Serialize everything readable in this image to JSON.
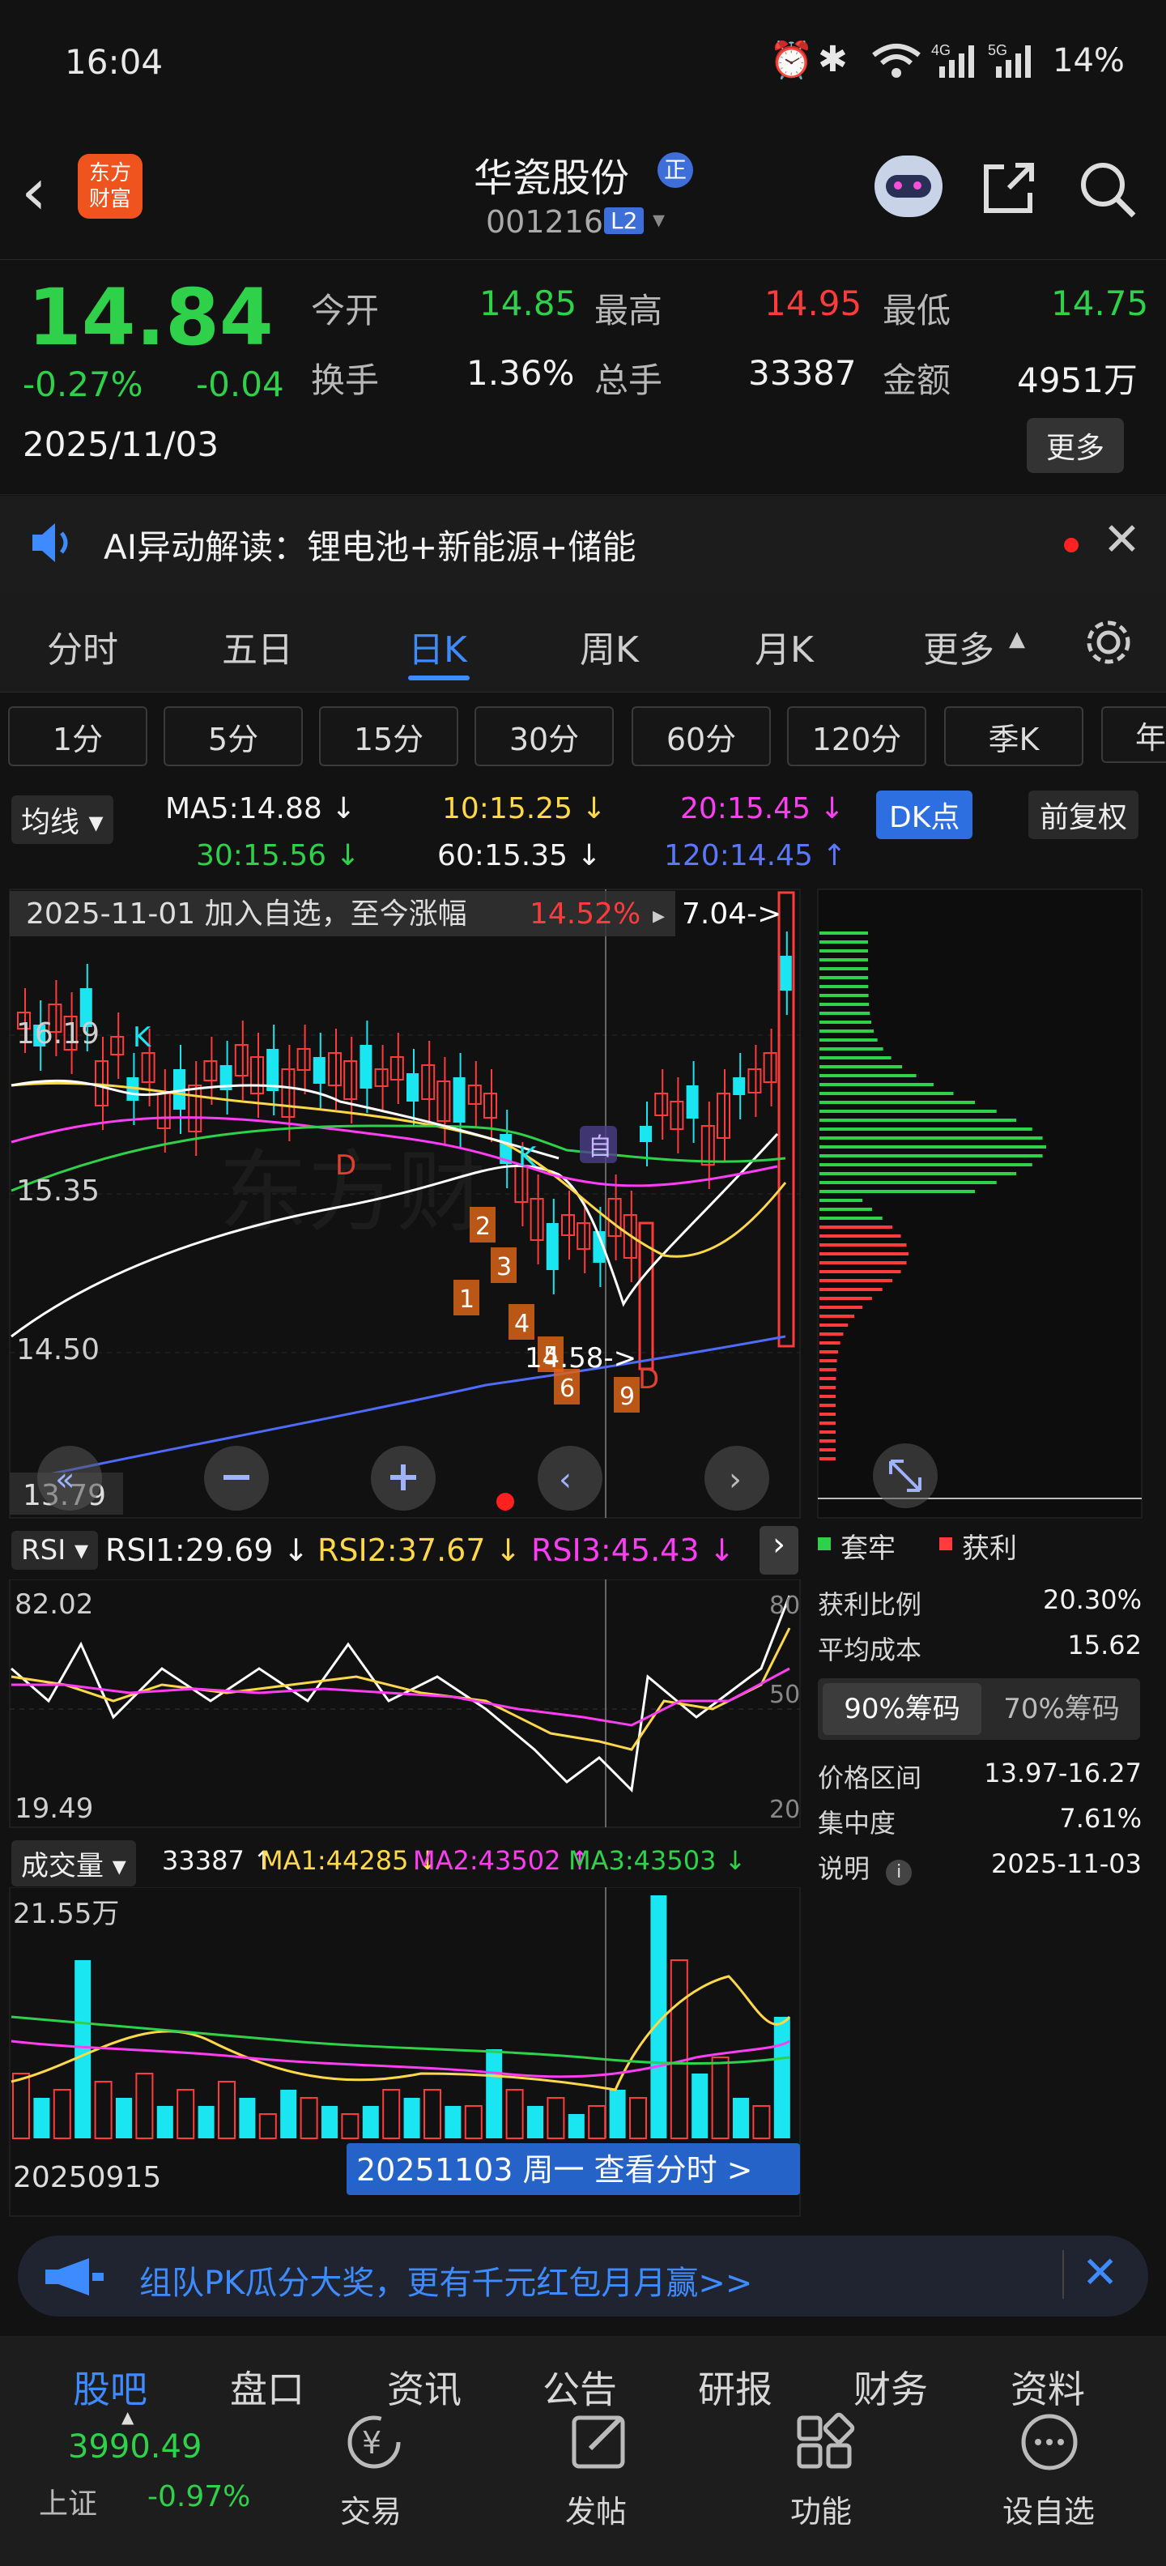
{
  "status_bar": {
    "time": "16:04",
    "network": "4G 5G",
    "battery": "14%"
  },
  "header": {
    "logo_text": "东方\n财富",
    "stock_name": "华瓷股份",
    "stock_badge": "正",
    "stock_code": "001216",
    "level_badge": "L2"
  },
  "quote": {
    "price": "14.84",
    "change_pct": "-0.27%",
    "change": "-0.04",
    "date": "2025/11/03",
    "open_label": "今开",
    "open": "14.85",
    "high_label": "最高",
    "high": "14.95",
    "low_label": "最低",
    "low": "14.75",
    "turnover_label": "换手",
    "turnover": "1.36%",
    "volume_label": "总手",
    "volume": "33387",
    "amount_label": "金额",
    "amount": "4951万",
    "more_button": "更多"
  },
  "ai_bar": {
    "text": "AI异动解读：锂电池+新能源+储能"
  },
  "tabs": [
    "分时",
    "五日",
    "日K",
    "周K",
    "月K",
    "更多"
  ],
  "active_tab": "日K",
  "periods": [
    "1分",
    "5分",
    "15分",
    "30分",
    "60分",
    "120分",
    "季K",
    "年"
  ],
  "ma_bar": {
    "selector": "均线",
    "ma5": "MA5:14.88 ↓",
    "ma10": "10:15.25 ↓",
    "ma20": "20:15.45 ↓",
    "ma30": "30:15.56 ↓",
    "ma60": "60:15.35 ↓",
    "ma120": "120:14.45 ↑",
    "dk_button": "DK点",
    "fq_button": "前复权"
  },
  "kline": {
    "banner_date": "2025-11-01 加入自选，至今涨幅",
    "banner_pct": "14.52%",
    "arrow_label": "7.04->",
    "y_high": "16.19",
    "y_mid": "15.35",
    "y_low": "14.50",
    "y_min": "13.79",
    "low_marker": "14.58->",
    "k_marker": "K",
    "d_marker": "D",
    "self_marker": "自",
    "seq_numbers": [
      "1",
      "2",
      "3",
      "4",
      "5",
      "6",
      "9"
    ]
  },
  "rsi": {
    "selector": "RSI",
    "rsi1": "RSI1:29.69 ↓",
    "rsi2": "RSI2:37.67 ↓",
    "rsi3": "RSI3:45.43 ↓",
    "y_top": "82.02",
    "y_bottom": "19.49",
    "right_top": "80",
    "right_mid": "50",
    "right_bottom": "20"
  },
  "volume": {
    "selector": "成交量",
    "vol": "33387 ↑",
    "ma1": "MA1:44285 ↓",
    "ma2": "MA2:43502 ↑",
    "ma3": "MA3:43503 ↓",
    "y_top": "21.55万",
    "start_date": "20250915",
    "current_banner": "20251103 周一 查看分时 >"
  },
  "chips": {
    "legend_trapped": "套牢",
    "legend_profit": "获利",
    "profit_ratio_label": "获利比例",
    "profit_ratio": "20.30%",
    "avg_cost_label": "平均成本",
    "avg_cost": "15.62",
    "tab_90": "90%筹码",
    "tab_70": "70%筹码",
    "range_label": "价格区间",
    "range": "13.97-16.27",
    "concentration_label": "集中度",
    "concentration": "7.61%",
    "note_label": "说明",
    "note_date": "2025-11-03"
  },
  "promo": {
    "text": "组队PK瓜分大奖，更有千元红包月月赢>>"
  },
  "bottom_tabs": [
    "股吧",
    "盘口",
    "资讯",
    "公告",
    "研报",
    "财务",
    "资料"
  ],
  "index": {
    "value": "3990.49",
    "name": "上证",
    "change": "-0.97%"
  },
  "bottom_actions": [
    {
      "label": "交易",
      "icon": "trade-icon"
    },
    {
      "label": "发帖",
      "icon": "post-icon"
    },
    {
      "label": "功能",
      "icon": "grid-icon"
    },
    {
      "label": "设自选",
      "icon": "more-icon"
    }
  ],
  "colors": {
    "up": "#ff3b3b",
    "down": "#2fd14a",
    "accent": "#3e8bff",
    "cyan": "#19e6f0"
  }
}
